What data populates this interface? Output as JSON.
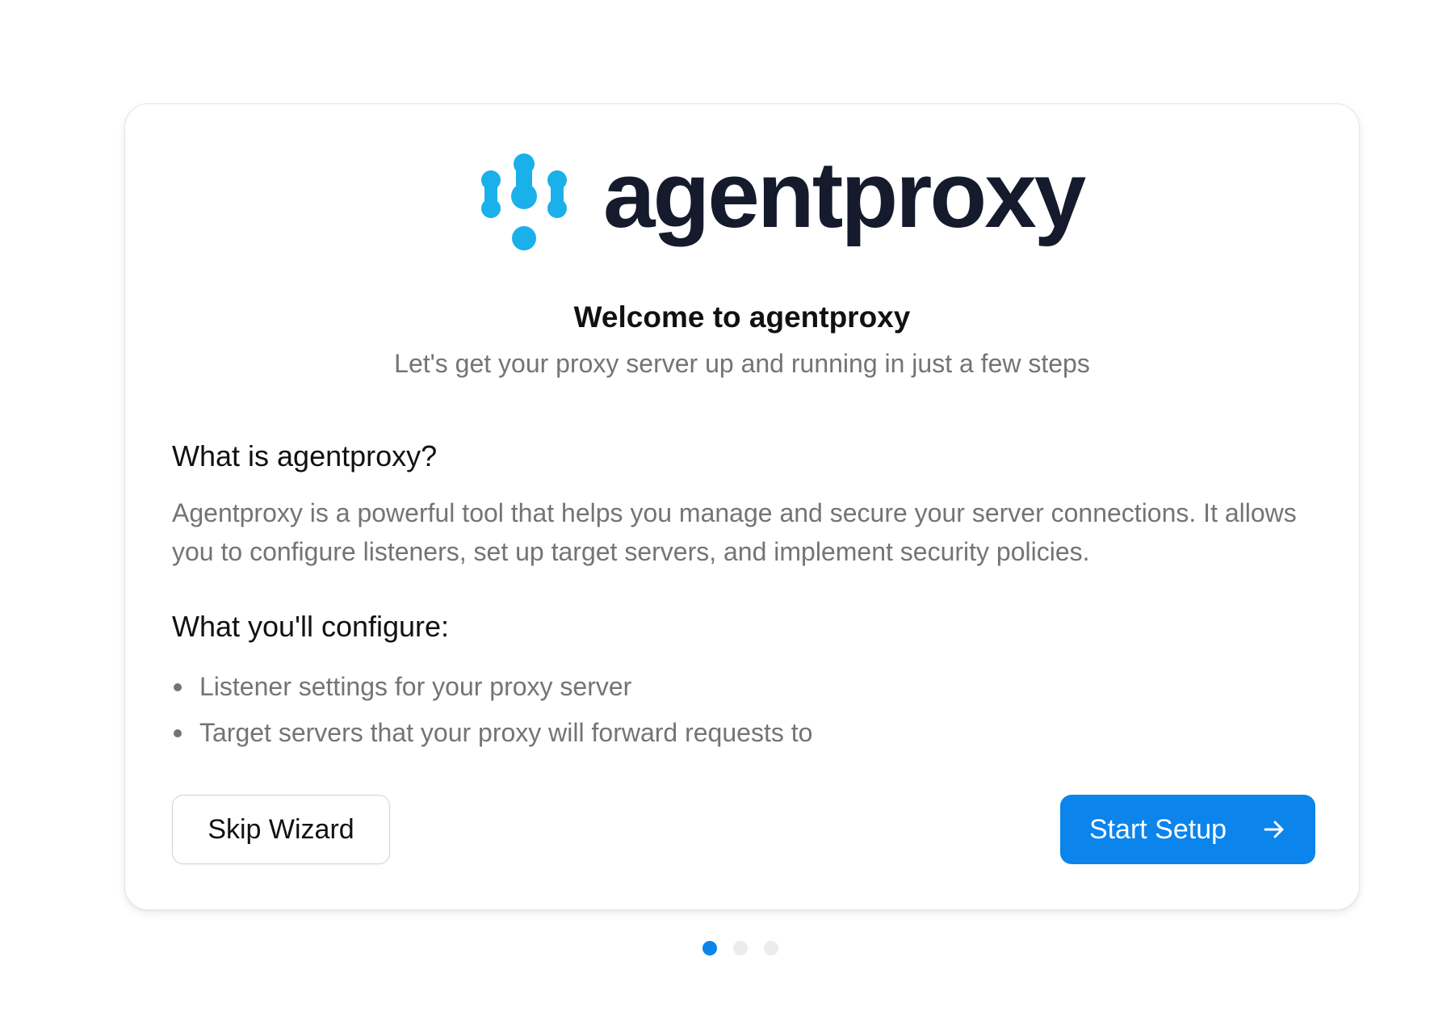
{
  "brand": {
    "logo_icon": "agentproxy-mark-icon",
    "name": "agentproxy",
    "accent_color": "#1ab0ea"
  },
  "welcome": {
    "title": "Welcome to agentproxy",
    "subtitle": "Let's get your proxy server up and running in just a few steps"
  },
  "about": {
    "title": "What is agentproxy?",
    "body": "Agentproxy is a powerful tool that helps you manage and secure your server connections. It allows you to configure listeners, set up target servers, and implement security policies."
  },
  "configure": {
    "title": "What you'll configure:",
    "items": [
      "Listener settings for your proxy server",
      "Target servers that your proxy will forward requests to"
    ]
  },
  "actions": {
    "skip_label": "Skip Wizard",
    "start_label": "Start Setup",
    "start_icon": "arrow-right-icon",
    "primary_color": "#0b84ec"
  },
  "pagination": {
    "total_steps": 3,
    "current_step": 1
  }
}
